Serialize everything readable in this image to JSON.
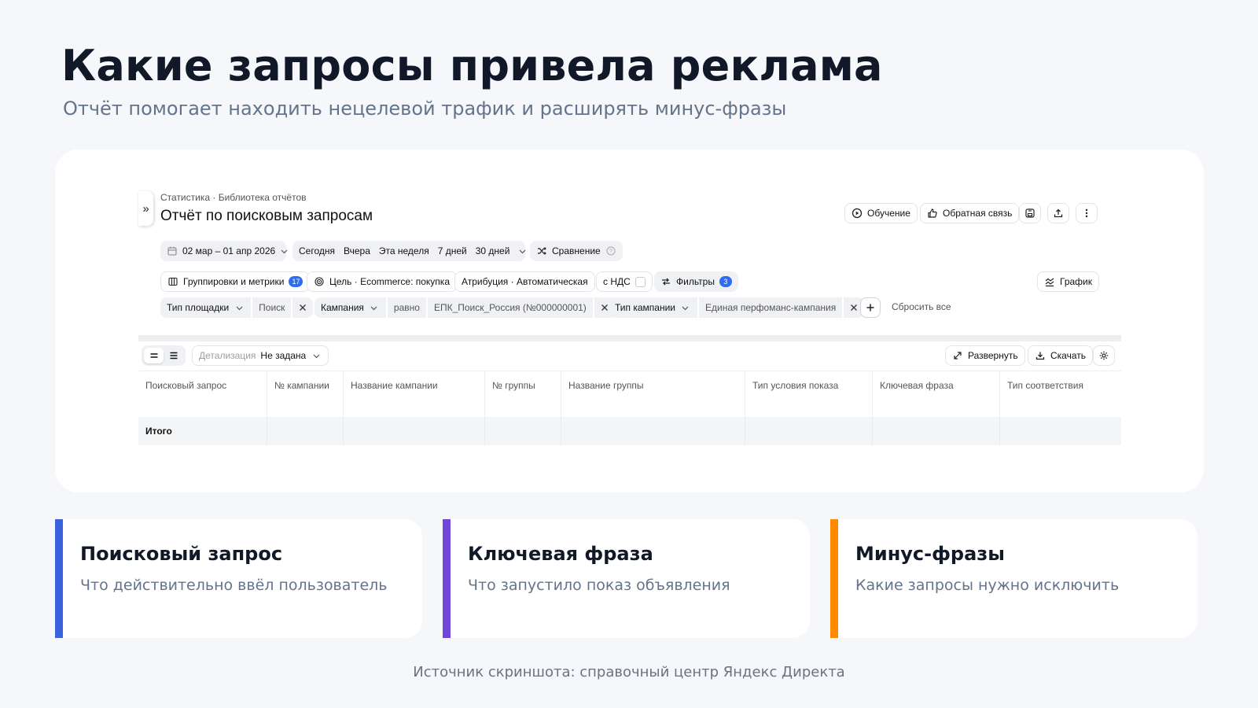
{
  "slide": {
    "title": "Какие запросы привела реклама",
    "subtitle": "Отчёт помогает находить нецелевой трафик и расширять минус-фразы"
  },
  "report": {
    "breadcrumb": "Статистика · Библиотека отчётов",
    "title": "Отчёт по поисковым запросам",
    "header_actions": {
      "learning": "Обучение",
      "feedback": "Обратная связь"
    },
    "date_range": "02 мар – 01 апр 2026",
    "quick_periods": [
      "Сегодня",
      "Вчера",
      "Эта неделя",
      "7 дней",
      "30 дней"
    ],
    "comparison": "Сравнение",
    "groupings": {
      "label": "Группировки и метрики",
      "count": "17"
    },
    "goal": "Цель · Ecommerce: покупка",
    "attribution": "Атрибуция · Автоматическая",
    "vat": "с НДС",
    "filters": {
      "label": "Фильтры",
      "count": "3"
    },
    "chart_button": "График",
    "filter_chips": [
      {
        "field": "Тип площадки",
        "operator": "",
        "value": "Поиск"
      },
      {
        "field": "Кампания",
        "operator": "равно",
        "value": "ЕПК_Поиск_Россия (№000000001)"
      },
      {
        "field": "Тип кампании",
        "operator": "",
        "value": "Единая перфоманс-кампания"
      }
    ],
    "reset_all": "Сбросить все",
    "detail": {
      "label": "Детализация",
      "value": "Не задана"
    },
    "expand": "Развернуть",
    "download": "Скачать",
    "columns": [
      "Поисковый запрос",
      "№ кампании",
      "Название кампании",
      "№ группы",
      "Название группы",
      "Тип условия показа",
      "Ключевая фраза",
      "Тип соответствия"
    ],
    "total_label": "Итого"
  },
  "features": [
    {
      "title": "Поисковый запрос",
      "description": "Что действительно ввёл пользователь",
      "accent": "#3b63e0"
    },
    {
      "title": "Ключевая фраза",
      "description": "Что запустило показ объявления",
      "accent": "#7047d6"
    },
    {
      "title": "Минус-фразы",
      "description": "Какие запросы нужно исключить",
      "accent": "#ff8a00"
    }
  ],
  "footer": "Источник скриншота: справочный центр Яндекс Директа"
}
